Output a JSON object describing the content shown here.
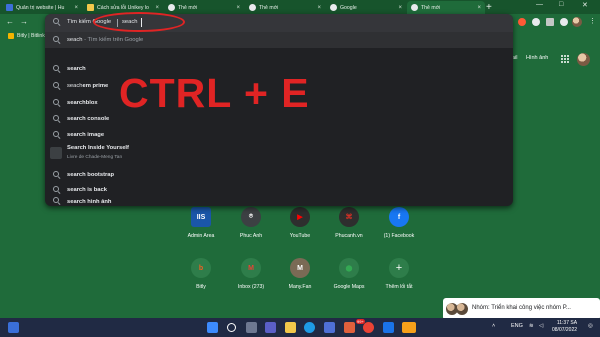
{
  "tabs": [
    {
      "title": "Quản trị website | Hu",
      "favicon": "website-favicon"
    },
    {
      "title": "Cách sửa lỗi Unikey lo",
      "favicon": "article-favicon"
    },
    {
      "title": "Thẻ mới",
      "favicon": "chrome-favicon"
    },
    {
      "title": "Thẻ mới",
      "favicon": "chrome-favicon"
    },
    {
      "title": "Google",
      "favicon": "google-favicon"
    },
    {
      "title": "Thẻ mới",
      "favicon": "chrome-favicon"
    }
  ],
  "window_controls": {
    "minimize": "—",
    "maximize": "□",
    "close": "✕"
  },
  "tab_close": "×",
  "new_tab": "+",
  "nav": {
    "back": "←",
    "forward": "→"
  },
  "bookmarks": [
    {
      "label": "Bitly | Bitlink"
    }
  ],
  "omnibox": {
    "chip": "Tìm kiếm Google",
    "query": "seach"
  },
  "suggestions": [
    {
      "bold": "seach",
      "rest": " - Tìm kiếm trên Google"
    },
    {
      "bold": "search",
      "rest": ""
    },
    {
      "bold": "seach",
      "rest": "em prime"
    },
    {
      "bold": "searchblox",
      "rest": ""
    },
    {
      "bold": "search console",
      "rest": ""
    },
    {
      "bold": "search image",
      "rest": ""
    },
    {
      "bold": "Search Inside Yourself",
      "rest": "",
      "sub": "Livre de Chade-Meng Tan"
    },
    {
      "bold": "search bootstrap",
      "rest": ""
    },
    {
      "bold": "search is back",
      "rest": ""
    },
    {
      "bold": "search hình ảnh",
      "rest": ""
    }
  ],
  "top_links": {
    "gmail": "ail",
    "images": "Hình ảnh"
  },
  "overlay_text": "CTRL + E",
  "shortcuts_row1": [
    {
      "label": "Admin Area",
      "glyph": "IIS",
      "color": "#1a56a8"
    },
    {
      "label": "Phuc Anh",
      "glyph": "⌾",
      "color": "#3c4043"
    },
    {
      "label": "YouTube",
      "glyph": "▶",
      "color": "#ff0000"
    },
    {
      "label": "Phucanh.vn",
      "glyph": "⌘",
      "color": "#d93025"
    },
    {
      "label": "(1) Facebook",
      "glyph": "f",
      "color": "#1877f2"
    }
  ],
  "shortcuts_row2": [
    {
      "label": "Bitly",
      "glyph": "b",
      "color": "#ee6123"
    },
    {
      "label": "Inbox (273)",
      "glyph": "M",
      "color": "#ea4335"
    },
    {
      "label": "Many.Fan",
      "glyph": "M",
      "color": "#7a6a55"
    },
    {
      "label": "Google Maps",
      "glyph": "⬤",
      "color": "#34a853"
    },
    {
      "label": "Thêm lối tắt",
      "glyph": "+",
      "color": "#e8eaed"
    }
  ],
  "notification": {
    "text": "Nhóm: Triển khai công việc nhóm P..."
  },
  "taskbar": {
    "lang": "ENG",
    "time": "11:37 SA",
    "date": "08/07/2022",
    "badge": "99+"
  }
}
